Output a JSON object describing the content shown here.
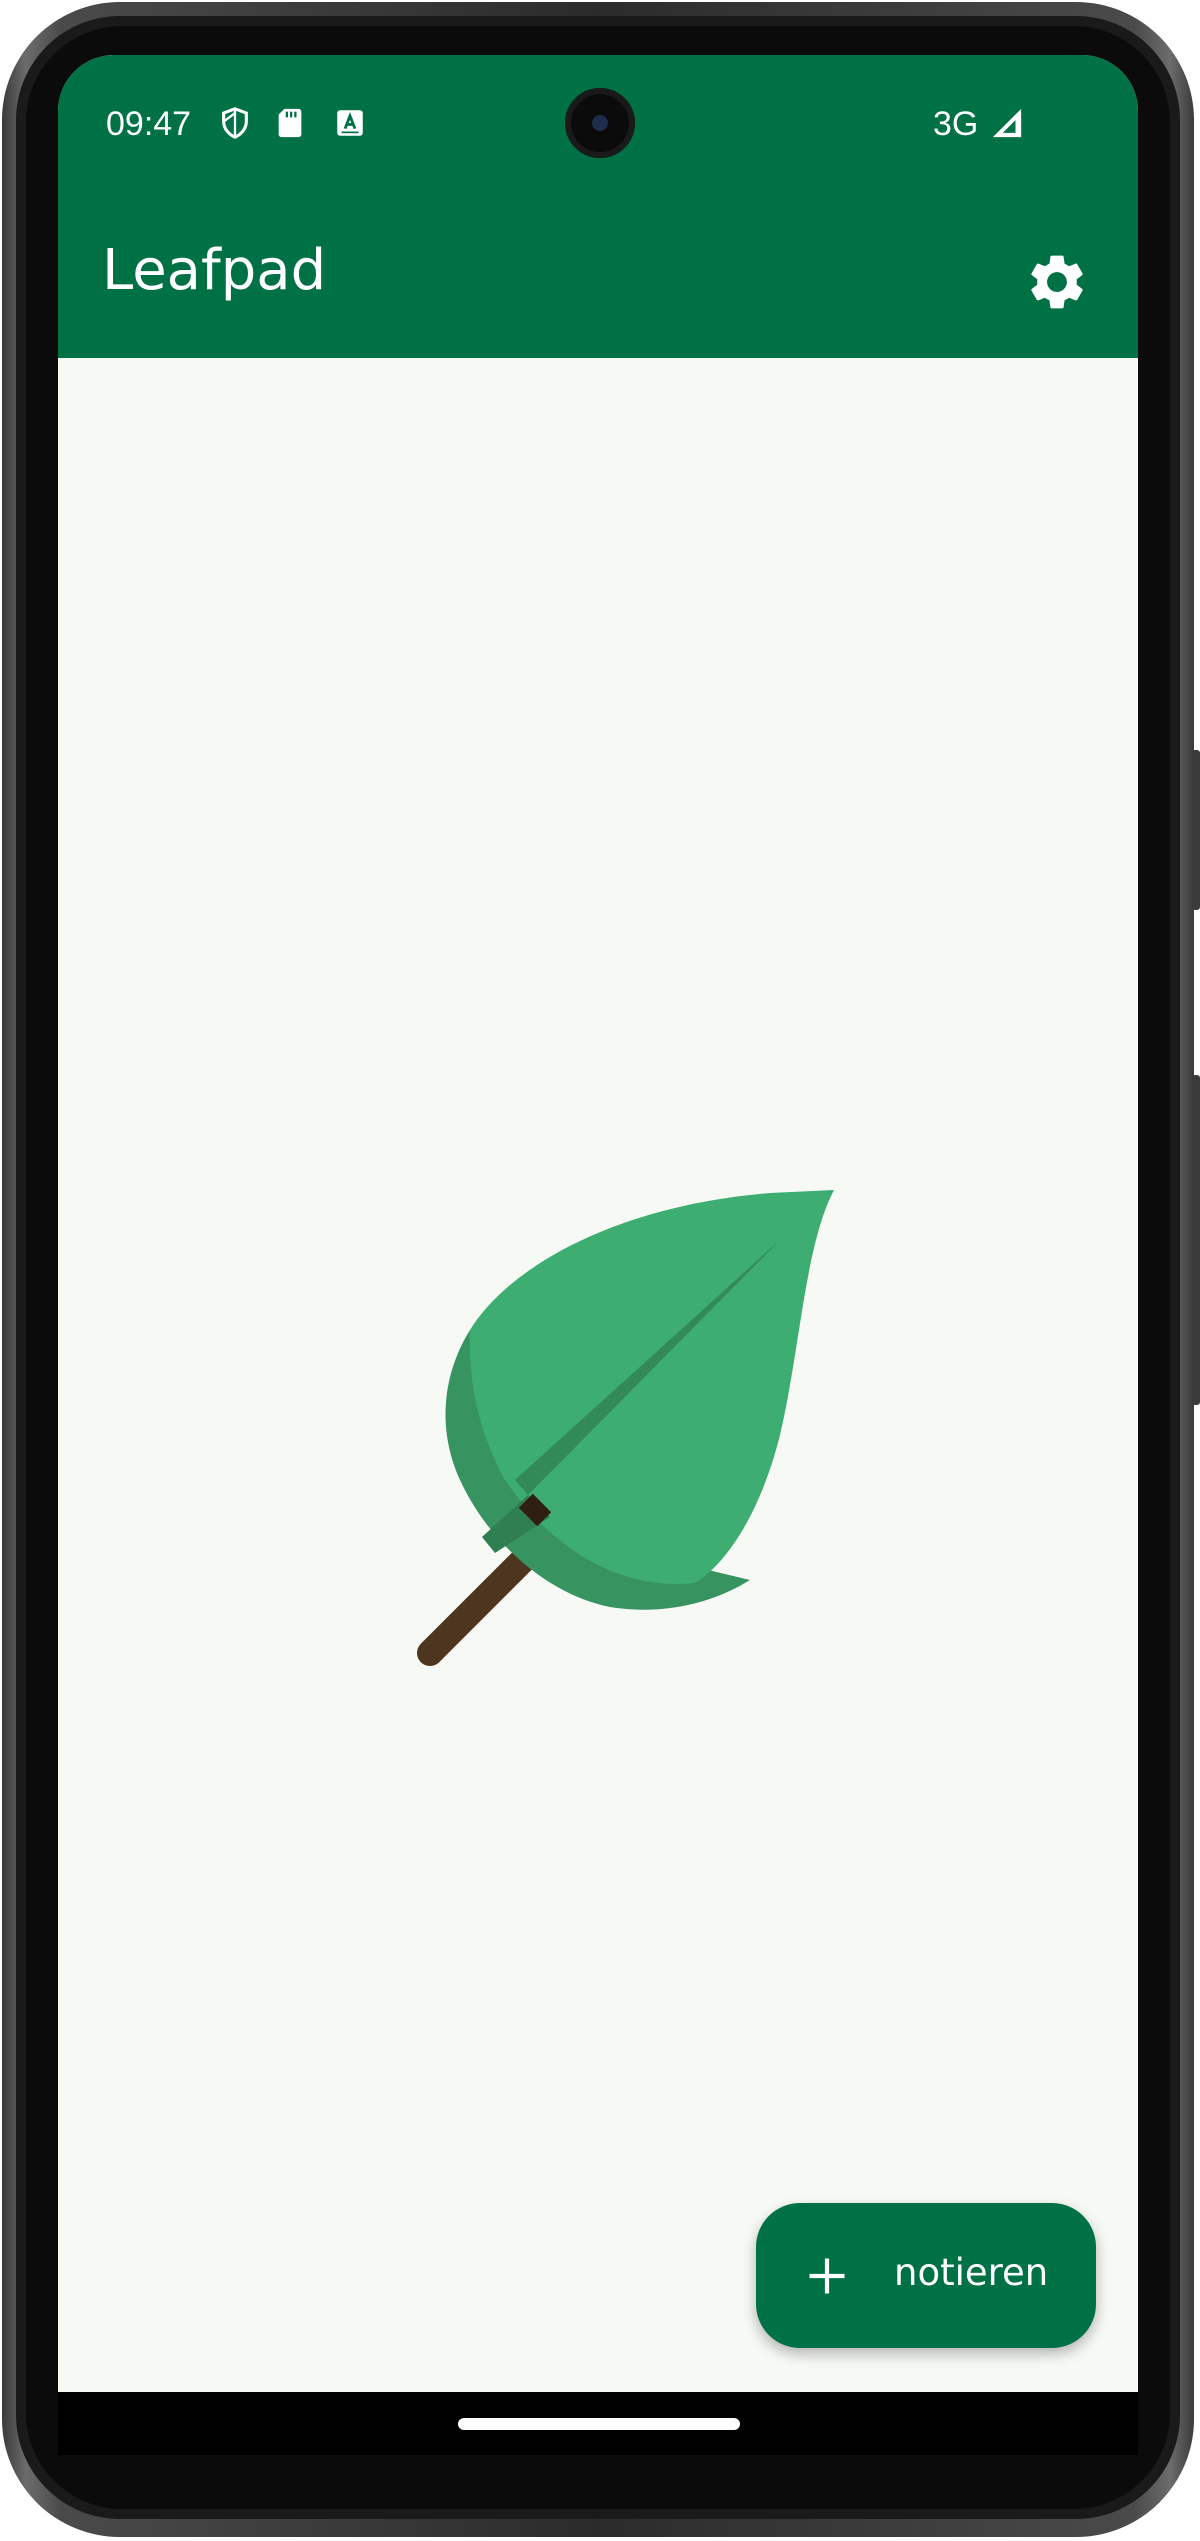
{
  "status_bar": {
    "time": "09:47",
    "network": "3G",
    "icons": [
      "shield-icon",
      "sd-card-icon",
      "keyboard-a-icon",
      "signal-icon"
    ]
  },
  "app_bar": {
    "title": "Leafpad",
    "settings_icon": "gear-icon"
  },
  "empty_state": {
    "illustration": "leaf-icon",
    "colors": {
      "leaf": "#3dad72",
      "leaf_shadow": "#37935f",
      "vein": "#2f7f52",
      "stem": "#4e3520"
    }
  },
  "fab": {
    "icon": "plus-icon",
    "label": "notieren"
  },
  "theme": {
    "primary": "#007144",
    "background": "#f7f9f5"
  }
}
